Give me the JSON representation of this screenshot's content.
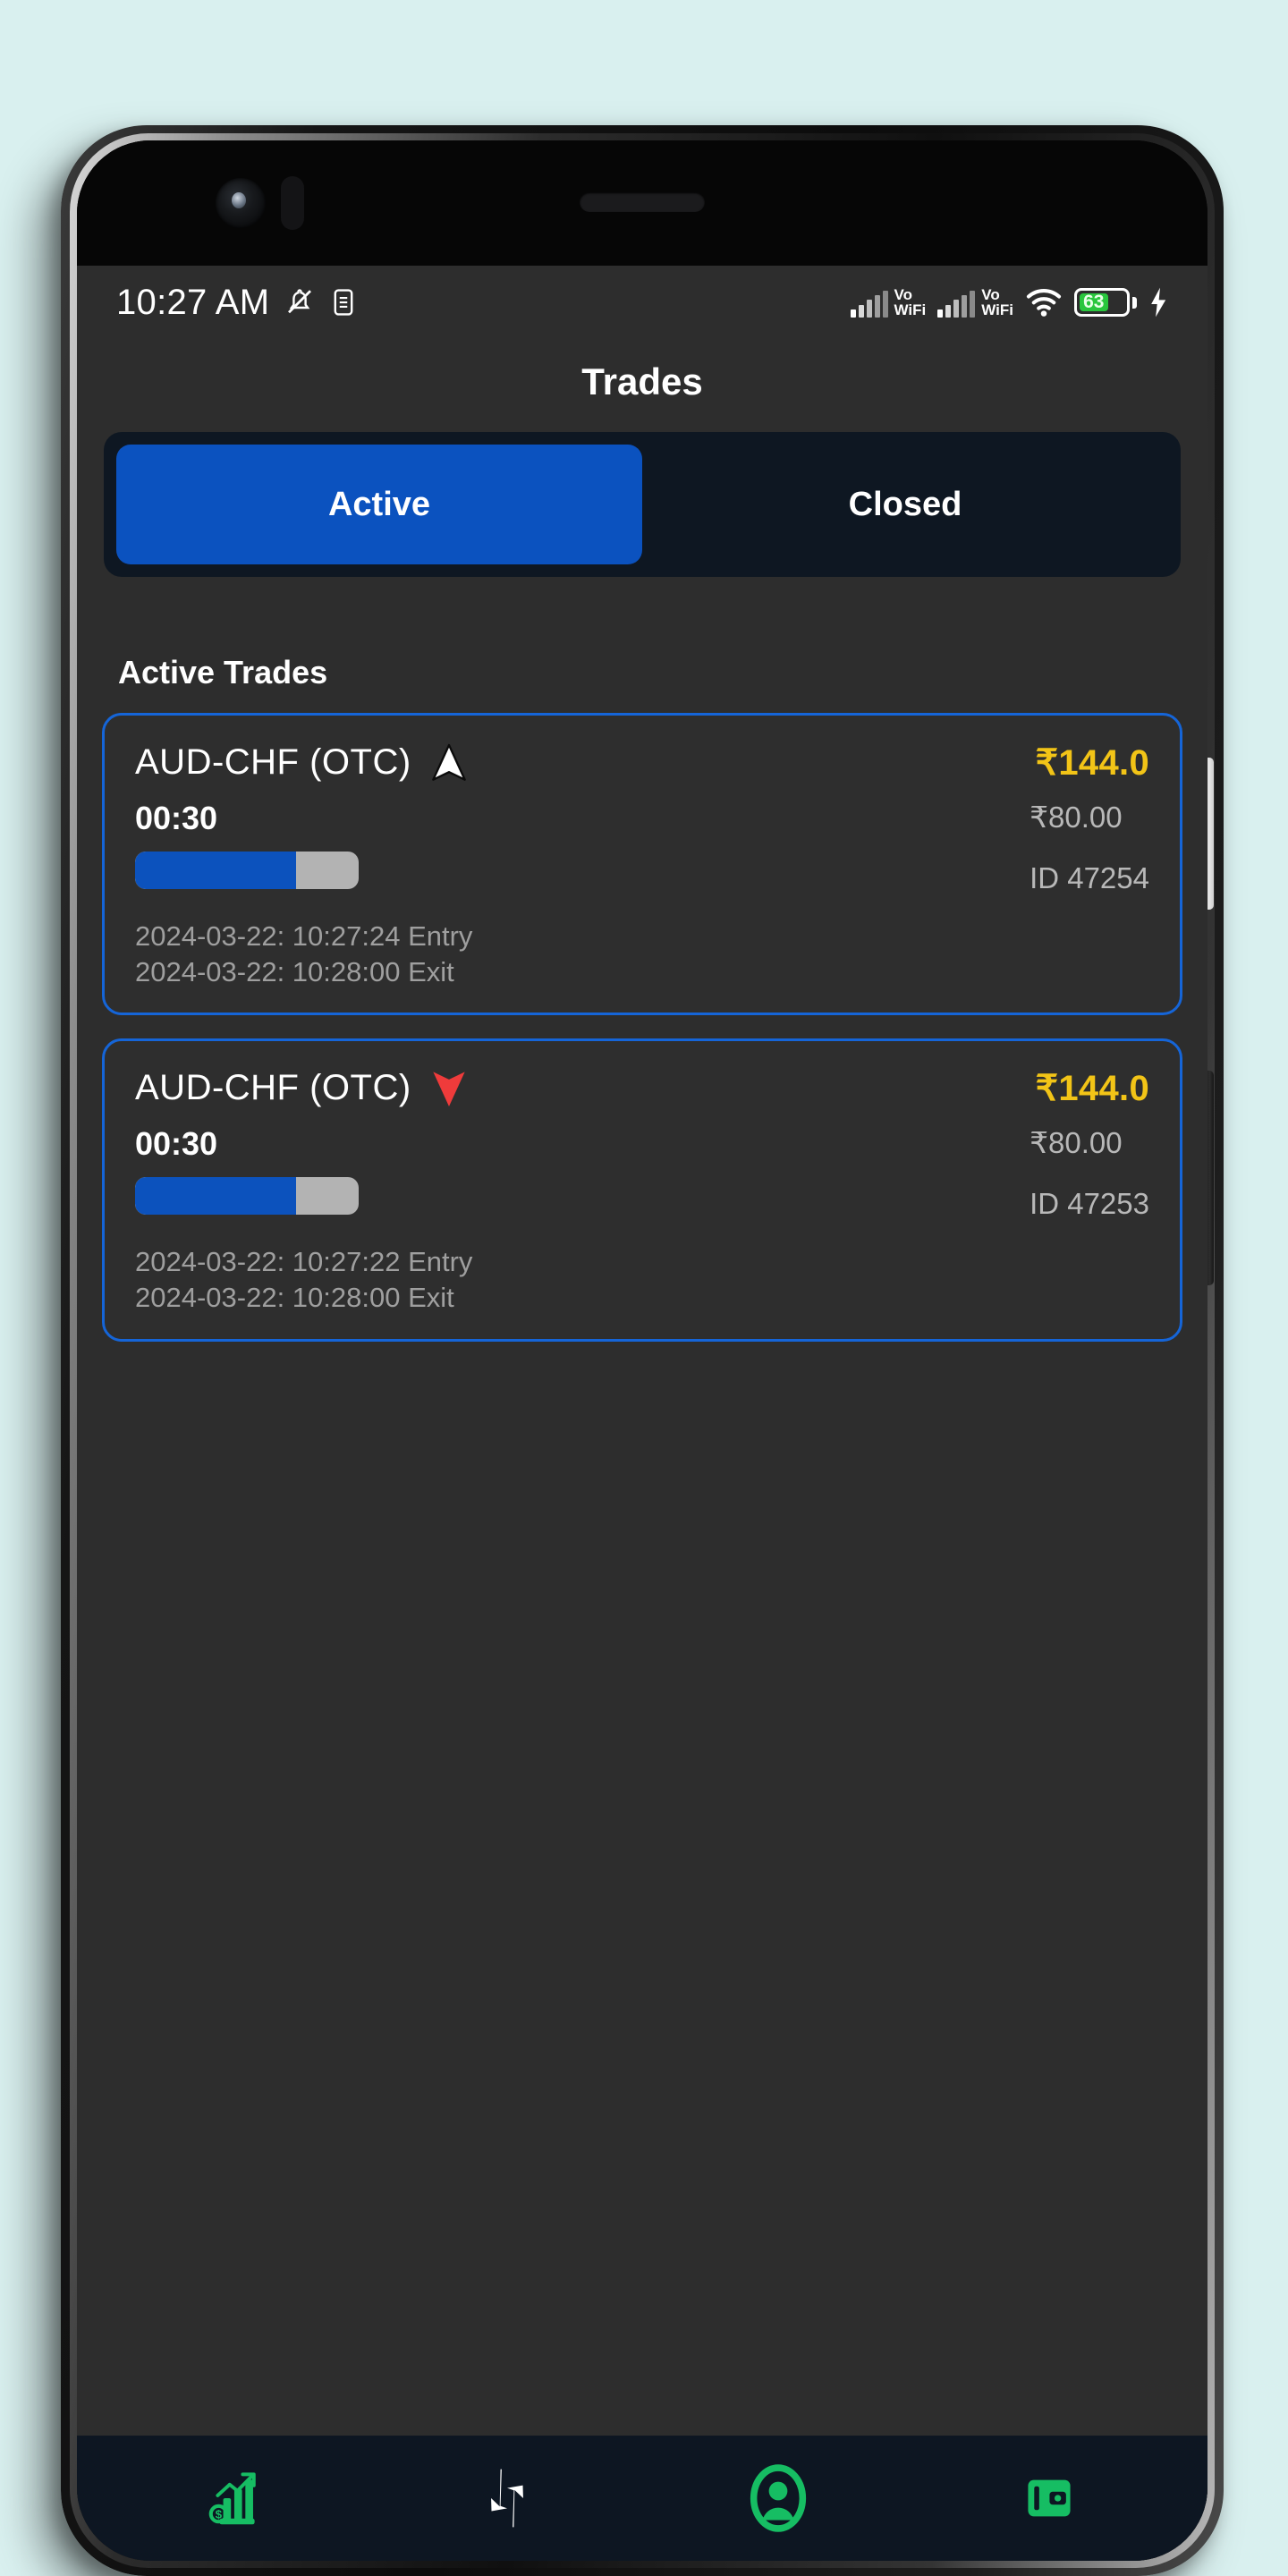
{
  "theme": {
    "page_background": "#d9f0ef",
    "app_background": "#2d2d2d",
    "accent_blue": "#0b52bf",
    "card_border": "#1565d8",
    "payout_yellow": "#f2c417",
    "nav_background": "#0d1622",
    "nav_icon_green": "#16bd63",
    "up_arrow_color": "#ffffff",
    "down_arrow_color": "#ef3b3b",
    "progress_track": "#b3b3b3",
    "progress_fill": "#0c52bd"
  },
  "status_bar": {
    "clock": "10:27 AM",
    "icons": [
      "bell-muted-icon",
      "nfc-icon",
      "signal-bars-icon",
      "vowifi-icon",
      "signal-bars-icon",
      "vowifi-icon",
      "wifi-icon",
      "battery-icon",
      "charging-bolt-icon"
    ],
    "volte_label_line1": "Vo",
    "volte_label_line2": "WiFi",
    "battery_percent": "63"
  },
  "header": {
    "title": "Trades"
  },
  "tabs": {
    "items": [
      {
        "label": "Active",
        "active": true
      },
      {
        "label": "Closed",
        "active": false
      }
    ]
  },
  "content": {
    "section_title": "Active Trades",
    "trades": [
      {
        "pair": "AUD-CHF (OTC)",
        "direction": "up",
        "payout": "₹144.0",
        "timer": "00:30",
        "amount": "₹80.00",
        "id": "ID 47254",
        "progress_percent": 72,
        "entry": "2024-03-22:  10:27:24 Entry",
        "exit": "2024-03-22:  10:28:00 Exit"
      },
      {
        "pair": "AUD-CHF (OTC)",
        "direction": "down",
        "payout": "₹144.0",
        "timer": "00:30",
        "amount": "₹80.00",
        "id": "ID 47253",
        "progress_percent": 72,
        "entry": "2024-03-22:  10:27:22 Entry",
        "exit": "2024-03-22:  10:28:00 Exit"
      }
    ]
  },
  "bottom_nav": {
    "items": [
      {
        "icon": "chart-growth-icon",
        "active": false
      },
      {
        "icon": "trade-arrows-icon",
        "active": true
      },
      {
        "icon": "account-person-icon",
        "active": false
      },
      {
        "icon": "wallet-icon",
        "active": false
      }
    ]
  }
}
